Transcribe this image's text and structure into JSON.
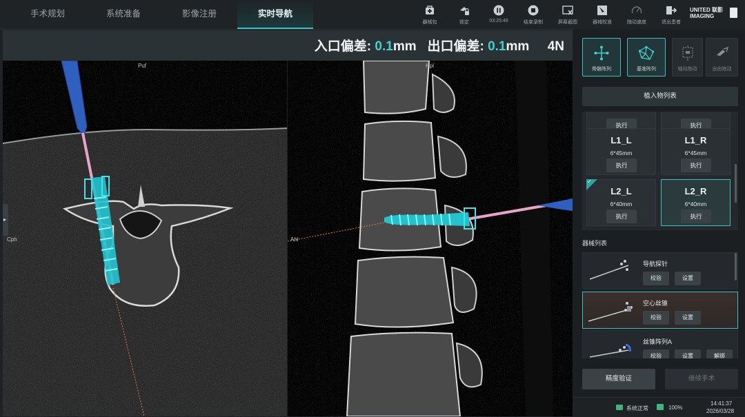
{
  "tabs": [
    "手术规划",
    "系统准备",
    "影像注册",
    "实时导航"
  ],
  "active_tab": 3,
  "toolbar": {
    "items": [
      {
        "label": "器械包",
        "icon": "kit-icon"
      },
      {
        "label": "锁定",
        "icon": "lock-icon"
      },
      {
        "label": "03:25:49",
        "icon": "pause-icon"
      },
      {
        "label": "结束录制",
        "icon": "stop-icon"
      },
      {
        "label": "屏幕截图",
        "icon": "screenshot-icon"
      },
      {
        "label": "器械校准",
        "icon": "calibrate-icon"
      },
      {
        "label": "随动速度",
        "icon": "speed-icon"
      },
      {
        "label": "退出患者",
        "icon": "exit-icon"
      }
    ]
  },
  "brand": {
    "line1": "UNITED 联影",
    "line2": "IMAGING"
  },
  "deviation": {
    "entry_label": "入口偏差:",
    "entry_value": "0.1",
    "exit_label": "出口偏差:",
    "exit_value": "0.1",
    "unit": "mm",
    "force": "4N"
  },
  "viewer_left": {
    "top_label": "Puf",
    "left_label": "Cph"
  },
  "viewer_right": {
    "top_label": "Hpl",
    "left_label": "Ahl"
  },
  "modes": [
    {
      "label": "骨骼阵列",
      "icon": "bone-array-icon",
      "state": "selected"
    },
    {
      "label": "基准阵列",
      "icon": "base-array-icon",
      "state": "selected"
    },
    {
      "label": "轴向拖动",
      "icon": "axial-drag-icon",
      "state": "disabled"
    },
    {
      "label": "自由拖动",
      "icon": "free-drag-icon",
      "state": "disabled"
    }
  ],
  "implant_list_button": "植入物列表",
  "implants": [
    {
      "name": "L1_L",
      "size": "6*45mm",
      "exec": "执行"
    },
    {
      "name": "L1_R",
      "size": "6*45mm",
      "exec": "执行"
    },
    {
      "name": "L2_L",
      "size": "6*40mm",
      "exec": "执行"
    },
    {
      "name": "L2_R",
      "size": "6*40mm",
      "exec": "执行"
    }
  ],
  "implant_top_exec": "执行",
  "instrument_title": "器械列表",
  "instruments": [
    {
      "name": "导航探针",
      "btn1": "校验",
      "btn2": "设置"
    },
    {
      "name": "空心丝锥",
      "btn1": "校验",
      "btn2": "设置"
    },
    {
      "name": "丝锥阵列A",
      "btn1": "校验",
      "btn2": "设置",
      "btn3": "解绑"
    }
  ],
  "accuracy_btn": "精度验证",
  "continue_btn": "继续手术",
  "status": {
    "system": "系统正常",
    "battery": "100%",
    "time": "14:41:37",
    "date": "2026/03/28"
  },
  "colors": {
    "accent": "#3fbfbf",
    "cyan_value": "#3fd0d0",
    "screw": "#2fd3e0",
    "trajectory": "#e9a3c9",
    "probe": "#2f5fbf"
  }
}
